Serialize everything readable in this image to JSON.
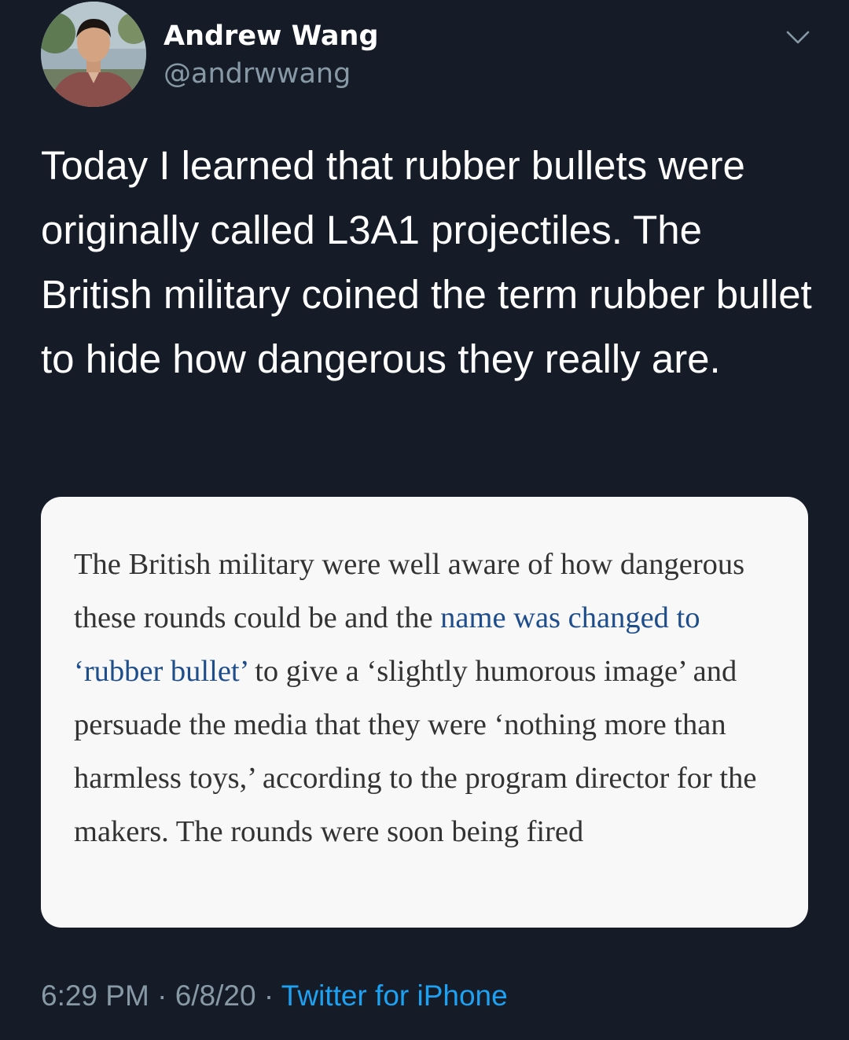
{
  "tweet": {
    "author": {
      "display_name": "Andrew Wang",
      "handle": "@andrwwang"
    },
    "text": "Today I learned that rubber bullets were originally called L3A1 projectiles. The British military coined the term rubber bullet to hide how dangerous they really are.",
    "media": {
      "segments": [
        {
          "text": "The British military were well aware of how dangerous these rounds could be and the ",
          "link": false
        },
        {
          "text": "name was changed to ‘rubber bullet’",
          "link": true
        },
        {
          "text": " to give a ‘slightly humorous image’ and persuade the media that they were ‘nothing more than harmless toys,’ according to the program director for the makers. The rounds were soon being fired",
          "link": false
        }
      ]
    },
    "meta": {
      "time": "6:29 PM",
      "separator": "·",
      "date": "6/8/20",
      "source": "Twitter for iPhone"
    }
  },
  "colors": {
    "background": "#151c28",
    "primary_text": "#ffffff",
    "secondary_text": "#8899a6",
    "accent": "#1da1f2",
    "card_background": "#f8f8f8",
    "card_text": "#333333",
    "card_link": "#1e4d8c"
  },
  "icons": {
    "menu": "chevron-down-icon"
  }
}
